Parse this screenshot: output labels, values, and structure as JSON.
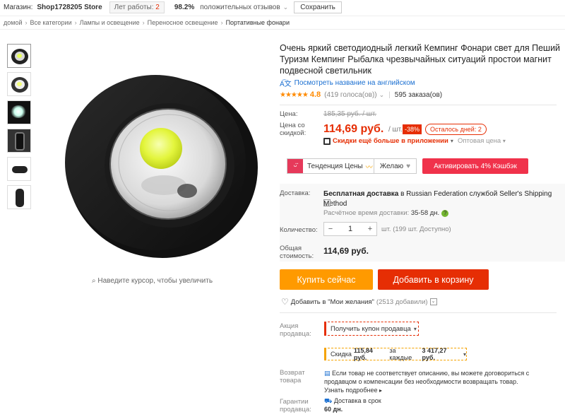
{
  "store_bar": {
    "store_label": "Магазин:",
    "store_name": "Shop1728205 Store",
    "years_label": "Лет работы:",
    "years_value": "2",
    "positive_pct": "98.2%",
    "positive_label": "положительных отзывов",
    "save_label": "Сохранить"
  },
  "breadcrumb": [
    "домой",
    "Все категории",
    "Лампы и освещение",
    "Переносное освещение",
    "Портативные фонари"
  ],
  "product": {
    "title": "Очень яркий светодиодный легкий Кемпинг Фонари свет для Пеший Туризм Кемпинг Рыбалка чрезвычайных ситуаций простои магнит подвесной светильник",
    "translate_link": "Посмотреть название на английском",
    "rating": "4.8",
    "stars": "★★★★★",
    "votes": "(419 голоса(ов))",
    "orders": "595 заказа(ов)"
  },
  "price": {
    "price_label": "Цена:",
    "old_price": "185,35 руб. / шт.",
    "discount_label": "Цена со скидкой:",
    "new_price": "114,69 руб.",
    "unit": "/ шт.",
    "discount_pct": "-38%",
    "days_left": "Осталось дней: 2",
    "app_discount": "Скидки ещё больше в приложении",
    "wholesale": "Оптовая цена"
  },
  "tools": {
    "trend_label": "Тенденция Цены",
    "wish_label": "Желаю",
    "cashback_label": "Активировать 4% Кэшбэк"
  },
  "shipping": {
    "label": "Доставка:",
    "free_prefix": "Бесплатная доставка",
    "free_rest": " в Russian Federation службой Seller's Shipping Method",
    "estimate_label": "Расчётное время доставки:",
    "estimate_value": "35-58 дн.",
    "qty_label": "Количество:",
    "qty_value": "1",
    "stock": "шт. (199 шт. Доступно)",
    "total_label": "Общая стоимость:",
    "total_value": "114,69 руб."
  },
  "actions": {
    "buy_now": "Купить сейчас",
    "add_to_cart": "Добавить в корзину",
    "wishlist": "Добавить в \"Мои желания\"",
    "wishlist_count": "(2513 добавили)"
  },
  "promo": {
    "label": "Акция продавца:",
    "coupon": "Получить купон продавца",
    "discount_prefix": "Скидка",
    "discount_amount": "115,84 руб.",
    "discount_mid": "за каждые",
    "discount_threshold": "3 417,27 руб."
  },
  "returns": {
    "label": "Возврат товара",
    "text": "Если товар не соответствует описанию, вы можете договориться с продавцом о компенсации без необходимости возвращать товар.",
    "more": "Узнать подробнее"
  },
  "guarantee": {
    "label": "Гарантии продавца:",
    "line1": "Доставка в срок",
    "line2": "60 дн."
  },
  "zoom_hint": "Наведите курсор, чтобы увеличить",
  "colors": {
    "accent": "#e62e04",
    "buy": "#ff9a00",
    "cashback": "#f0324b",
    "link": "#1a6fd1",
    "rating": "#ff8a00"
  }
}
